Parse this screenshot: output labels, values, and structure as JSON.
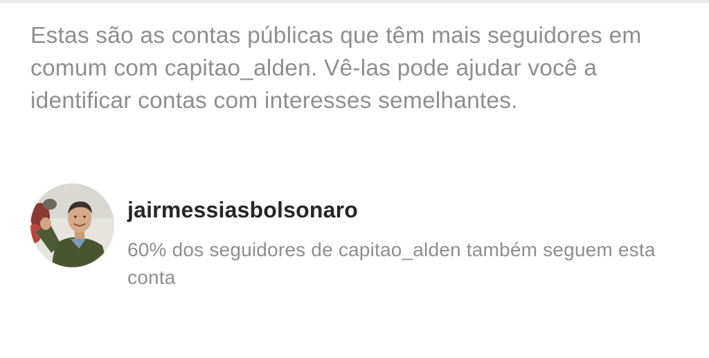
{
  "info": {
    "description": "Estas são as contas públicas que têm mais seguidores em comum com capitao_alden. Vê-las pode ajudar você a identificar contas com interesses semelhantes."
  },
  "accounts": [
    {
      "username": "jairmessiasbolsonaro",
      "subtitle": "60% dos seguidores de capitao_alden também seguem esta conta",
      "avatar_icon": "profile-photo"
    }
  ],
  "colors": {
    "primary_text": "#262626",
    "secondary_text": "#8e8e8e",
    "background": "#ffffff"
  }
}
